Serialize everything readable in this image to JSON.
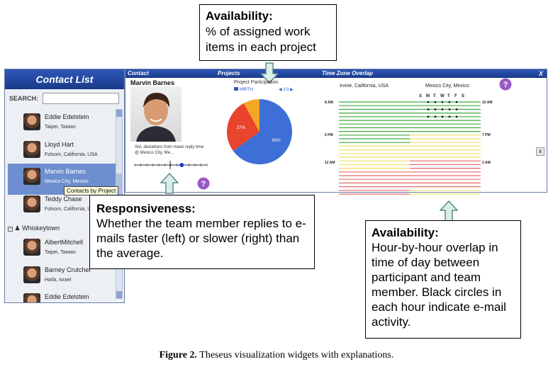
{
  "callouts": {
    "top": {
      "title": "Availability:",
      "text": "% of assigned work items in each project"
    },
    "responsiveness": {
      "title": "Responsiveness:",
      "text": "Whether the team member replies to e-mails faster (left) or slower (right) than the average."
    },
    "availability": {
      "title": "Availability:",
      "text": "Hour-by-hour overlap in time of day between participant and team member. Black circles in each hour indicate e-mail activity."
    }
  },
  "contact_list": {
    "title": "Contact List",
    "search_label": "SEARCH:",
    "search_value": "",
    "group_header": "Whiskeytown",
    "tooltip": "Contacts by Project",
    "entries": [
      {
        "name": "Eddie Edelstein",
        "location": "Taipei, Taiwan"
      },
      {
        "name": "Lloyd Hart",
        "location": "Folsom, California, USA"
      },
      {
        "name": "Marvin Barnes",
        "location": "Mexico City, Mexico"
      },
      {
        "name": "Teddy Chase",
        "location": "Folsom, California, U"
      },
      {
        "name": "AlbertMitchell",
        "location": "Taipei, Taiwan"
      },
      {
        "name": "Barney Crutcher",
        "location": "Haifa, Israel"
      },
      {
        "name": "Eddie Edelstein",
        "location": ""
      }
    ]
  },
  "main": {
    "tabs": [
      "Contact",
      "Projects",
      "Time Zone Overlap"
    ],
    "close_label": "X",
    "side_close": "x",
    "contact_name": "Marvin Barnes",
    "contact_caption": "Std. deviations from mean reply time @ Mexico City, Me...",
    "responsiveness_value": 0.65,
    "project_participation": {
      "title": "Project Participation",
      "legend": "MIRTH",
      "nav": "◀ 1/3 ▶",
      "slices": [
        {
          "label": "65%",
          "value": 65,
          "color": "#3d6fd6"
        },
        {
          "label": "27%",
          "value": 27,
          "color": "#e8452c"
        },
        {
          "label": "",
          "value": 8,
          "color": "#f5a623"
        }
      ]
    },
    "time_zone": {
      "left_location": "Irvine, California, USA",
      "right_location": "Mexico City, Mexico",
      "days": [
        "S",
        "M",
        "T",
        "W",
        "T",
        "F",
        "S"
      ],
      "left_times": [
        "8 AM",
        "5 PM",
        "12 AM"
      ],
      "right_times": [
        "10 AM",
        "7 PM",
        "2 AM"
      ]
    }
  },
  "caption": {
    "bold": "Figure 2.",
    "text": " Theseus visualization widgets with explanations."
  },
  "colors": {
    "header_blue": "#1f45a0",
    "selection_blue": "#6d8fd0",
    "help_purple": "#9b59c8",
    "arrow_fill": "#dbeee9"
  }
}
